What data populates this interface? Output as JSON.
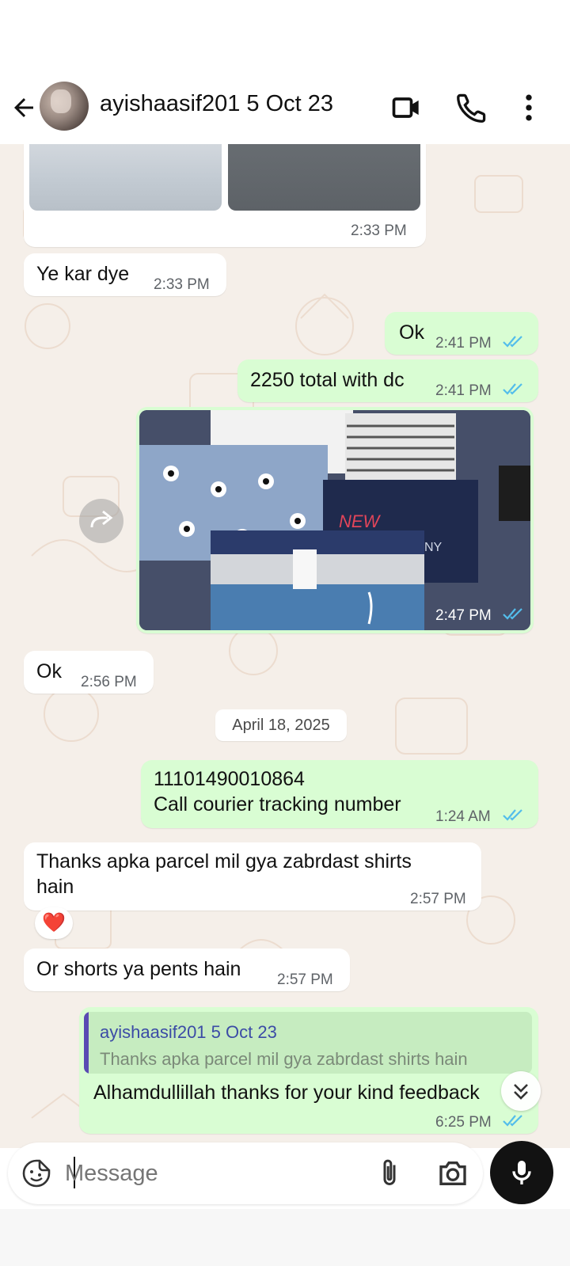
{
  "header": {
    "title": "ayishaasif201 5 Oct 23",
    "icons": [
      "back-arrow-icon",
      "video-call-icon",
      "voice-call-icon",
      "more-options-icon"
    ]
  },
  "messages": {
    "m1_time": "2:33 PM",
    "m2_text": "Ye kar dye",
    "m2_time": "2:33 PM",
    "m3_text": "Ok",
    "m3_time": "2:41 PM",
    "m4_text": "2250 total with dc",
    "m4_time": "2:41 PM",
    "m5_time": "2:47 PM",
    "m6_text": "Ok",
    "m6_time": "2:56 PM",
    "date_chip": "April 18, 2025",
    "m7_line1": "11101490010864",
    "m7_line2": "Call courier tracking number",
    "m7_time": "1:24 AM",
    "m8_line1": "Thanks apka parcel mil gya zabrdast shirts",
    "m8_line2": "hain",
    "m8_time": "2:57 PM",
    "m8_reaction": "❤️",
    "m9_text": "Or shorts ya pents hain",
    "m9_time": "2:57 PM",
    "m10_quote_name": "ayishaasif201 5 Oct 23",
    "m10_quote_text": "Thanks apka parcel mil gya zabrdast shirts hain",
    "m10_text": "Alhamdullillah thanks for your kind feedback",
    "m10_time": "6:25 PM"
  },
  "composer": {
    "placeholder": "Message"
  },
  "colors": {
    "incoming": "#ffffff",
    "outgoing": "#d9fdd3",
    "read_ticks": "#53bdeb",
    "chat_bg": "#f5efe9"
  }
}
